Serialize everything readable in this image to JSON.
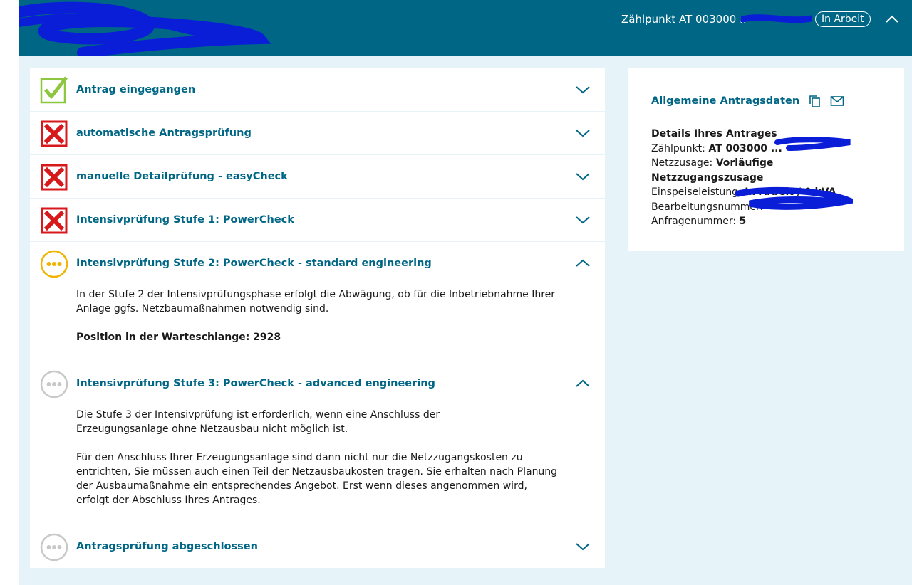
{
  "header": {
    "zaehlpunkt_label": "Zählpunkt AT 003000 ..",
    "status_badge": "In Arbeit"
  },
  "colors": {
    "brand": "#006685",
    "background": "#e6f4fa",
    "success": "#8dc63f",
    "error": "#d7191c",
    "pending": "#f0b400",
    "inactive": "#c8c8c8"
  },
  "steps": [
    {
      "title": "Antrag eingegangen",
      "status_icon": "check-icon",
      "expanded": false
    },
    {
      "title": "automatische Antragsprüfung",
      "status_icon": "error-icon",
      "expanded": false
    },
    {
      "title": "manuelle Detailprüfung - easyCheck",
      "status_icon": "error-icon",
      "expanded": false
    },
    {
      "title": "Intensivprüfung Stufe 1: PowerCheck",
      "status_icon": "error-icon",
      "expanded": false
    },
    {
      "title": "Intensivprüfung Stufe 2: PowerCheck - standard engineering",
      "status_icon": "in-progress-icon",
      "expanded": true,
      "body": [
        "In der Stufe 2 der Intensivprüfungsphase erfolgt die Abwägung, ob für die Inbetriebnahme Ihrer Anlage ggfs. Netzbaumaßnahmen notwendig sind."
      ],
      "queue_position": "Position in der Warteschlange: 2928"
    },
    {
      "title": "Intensivprüfung Stufe 3: PowerCheck - advanced engineering",
      "status_icon": "pending-icon",
      "expanded": true,
      "body": [
        "Die Stufe 3 der Intensivprüfung ist erforderlich, wenn eine Anschluss der Erzeugungsanlage ohne Netzausbau nicht möglich ist.",
        "Für den Anschluss Ihrer Erzeugungsanlage sind dann nicht nur die Netzzugangskosten zu entrichten, Sie müssen auch einen Teil der Netzausbaukosten tragen. Sie erhalten nach Planung der Ausbaumaßnahme ein entsprechendes Angebot. Erst wenn dieses angenommen wird, erfolgt der Abschluss Ihres Antrages."
      ]
    },
    {
      "title": "Antragsprüfung abgeschlossen",
      "status_icon": "pending-icon",
      "expanded": false
    }
  ],
  "info_card": {
    "title": "Allgemeine Antragsdaten",
    "details_heading": "Details Ihres Antrages",
    "zaehlpunkt_label": "Zählpunkt: ",
    "zaehlpunkt_value": "AT 003000 ...",
    "netzzusage_label": "Netzzusage: ",
    "netzzusage_value": "Vorläufige Netzzugangszusage",
    "einspeise_label": "Einspeiseleistung: ",
    "einspeise_value": "In Arbeit / 0 kVA",
    "bearbeitung_label": "Bearbeitungsnummer: ",
    "anfrage_label": "Anfragenummer: ",
    "anfrage_value": "5"
  }
}
